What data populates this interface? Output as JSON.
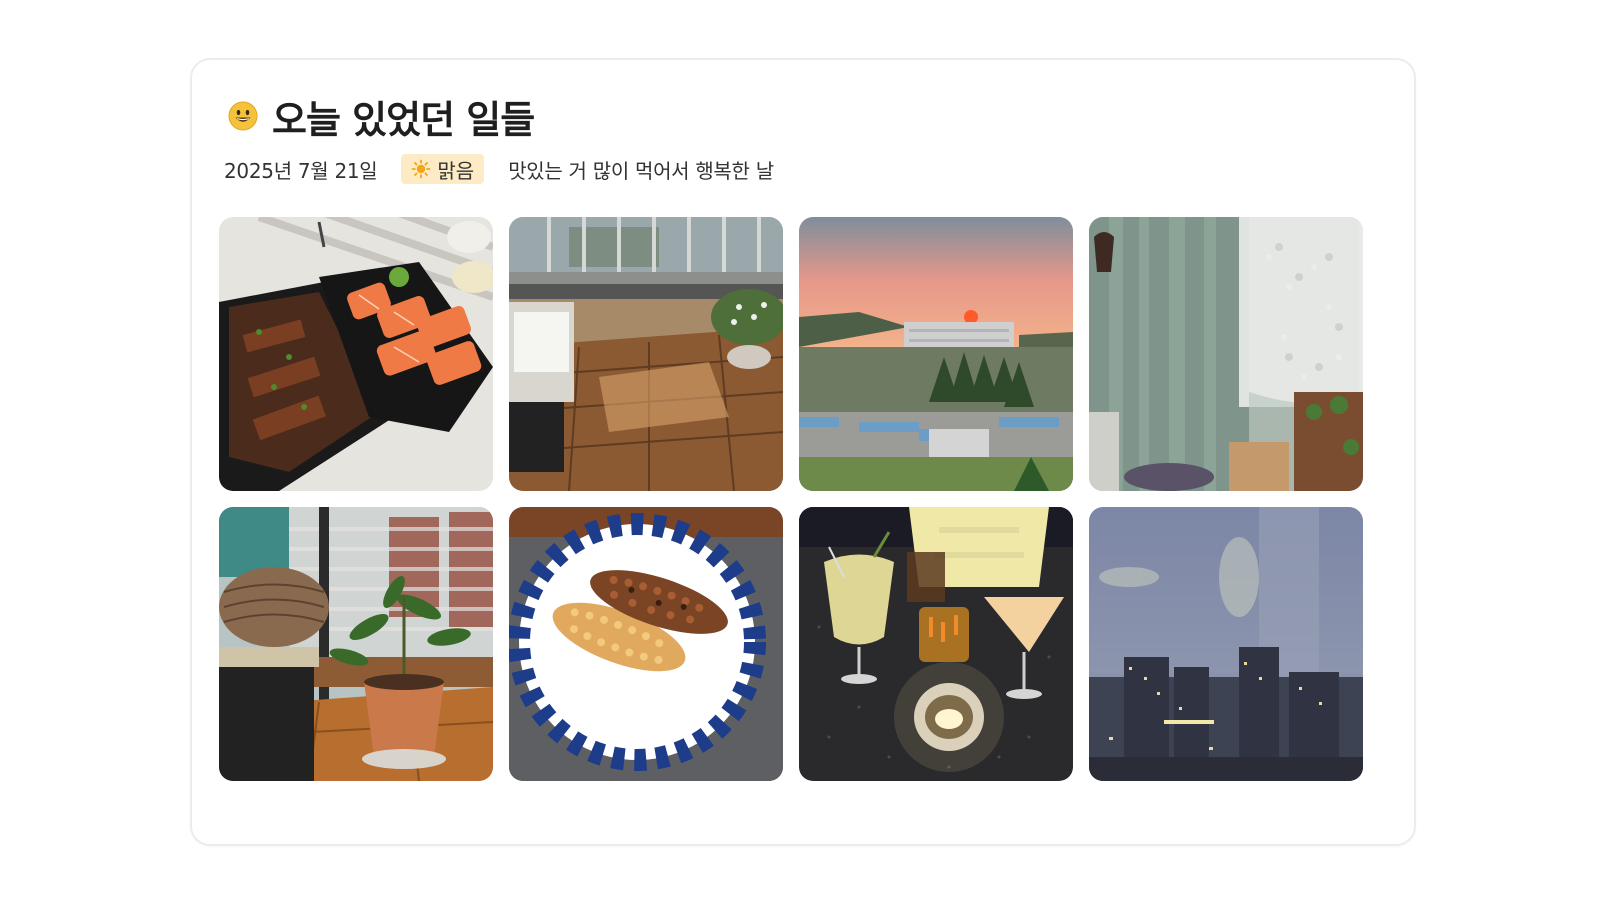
{
  "diary": {
    "title": "오늘 있었던 일들",
    "title_icon": "smiley-face-icon",
    "date": "2025년 7월 21일",
    "weather": {
      "label": "맑음",
      "icon": "sun-icon"
    },
    "memo": "맛있는 거 많이 먹어서 행복한 날"
  },
  "colors": {
    "weather_badge_bg": "#fdebc5",
    "card_border": "#ececec"
  },
  "photos": [
    {
      "subject": "salmon-sushi-and-grilled-meat-photo"
    },
    {
      "subject": "balcony-with-wooden-deck-photo"
    },
    {
      "subject": "sunset-over-apartments-photo"
    },
    {
      "subject": "curtains-by-window-photo"
    },
    {
      "subject": "plant-on-balcony-photo"
    },
    {
      "subject": "grilled-corn-on-plate-photo"
    },
    {
      "subject": "cocktails-and-candle-photo"
    },
    {
      "subject": "cloudy-night-city-photo"
    }
  ]
}
